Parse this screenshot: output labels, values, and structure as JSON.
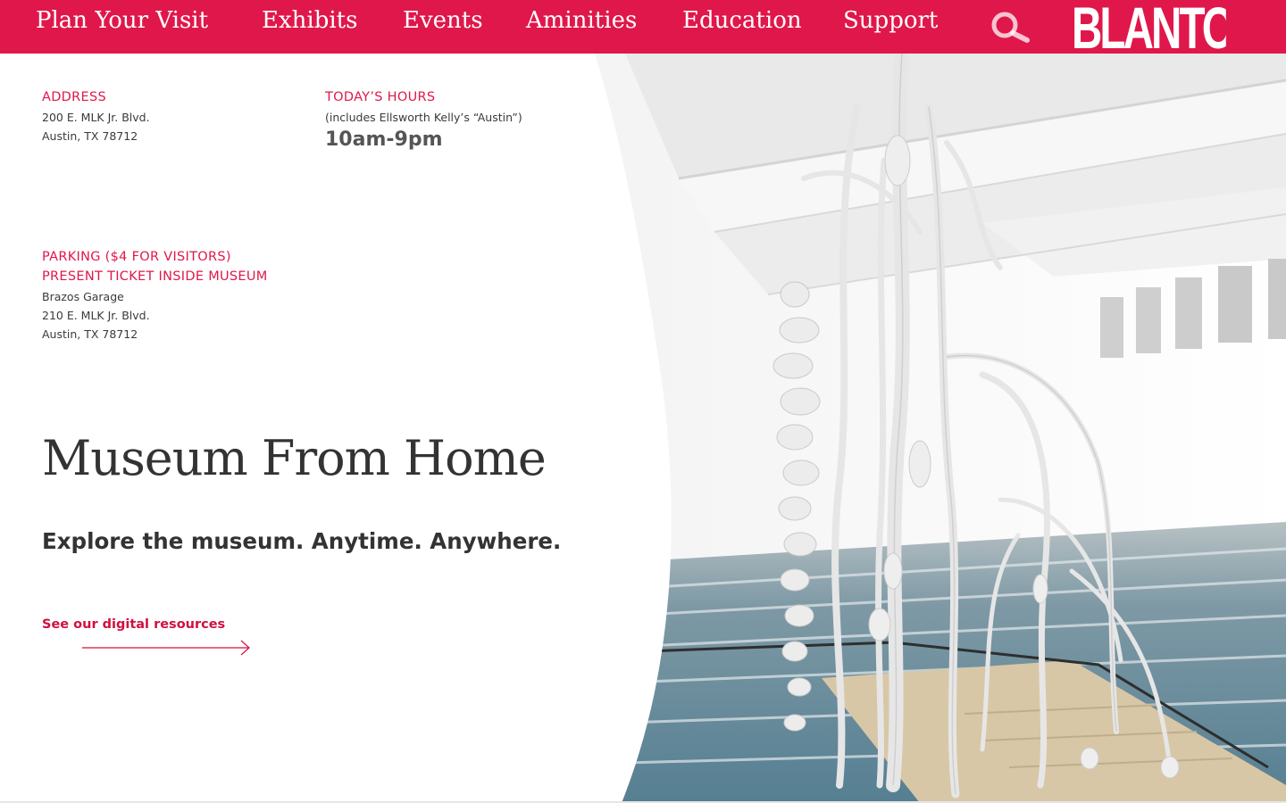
{
  "nav": {
    "items": [
      "Plan Your Visit",
      "Exhibits",
      "Events",
      "Aminities",
      "Education",
      "Support"
    ],
    "search_icon": "search-icon",
    "logo_text": "BLANTON",
    "bg_color": "#e0174a"
  },
  "address": {
    "label": "ADDRESS",
    "line1": "200 E. MLK Jr. Blvd.",
    "line2": "Austin, TX 78712"
  },
  "hours": {
    "label": "TODAY’S HOURS",
    "note": "(includes Ellsworth Kelly’s “Austin”)",
    "value": "10am-9pm"
  },
  "parking": {
    "label1": "PARKING ($4 FOR VISITORS)",
    "label2": "PRESENT TICKET INSIDE MUSEUM",
    "line1": "Brazos Garage",
    "line2": "210 E. MLK Jr. Blvd.",
    "line3": "Austin, TX 78712"
  },
  "hero": {
    "title": "Museum From Home",
    "subtitle": "Explore the museum. Anytime. Anywhere.",
    "cta": "See our digital resources",
    "arrow_icon": "arrow-right-icon"
  },
  "image": {
    "subject": "gallery-sculpture-image"
  },
  "colors": {
    "accent": "#e0174a",
    "text": "#333333"
  }
}
